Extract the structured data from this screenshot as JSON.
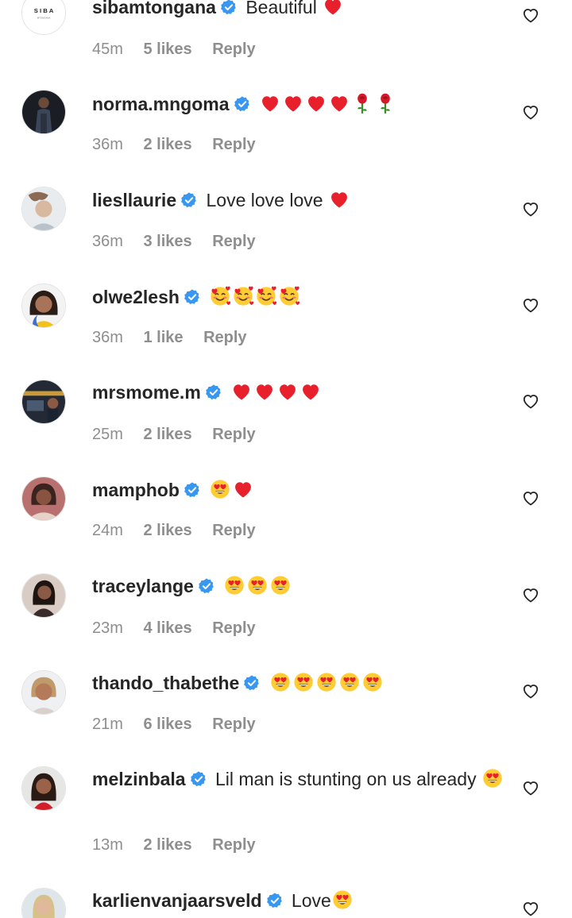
{
  "colors": {
    "text": "#262626",
    "meta": "#8e8e8e",
    "verified": "#3897f0",
    "heart": "#e8202c"
  },
  "comments": [
    {
      "username": "sibamtongana",
      "text": "Beautiful",
      "emoji": [
        "red-heart"
      ],
      "time": "45m",
      "likes": "5 likes",
      "reply": "Reply",
      "avatar_text": "S I B A",
      "avatar_subtext": "MTONGANA"
    },
    {
      "username": "norma.mngoma",
      "text": "",
      "emoji": [
        "red-heart",
        "red-heart",
        "red-heart",
        "red-heart",
        "rose",
        "rose"
      ],
      "time": "36m",
      "likes": "2 likes",
      "reply": "Reply"
    },
    {
      "username": "liesllaurie",
      "text": "Love love love",
      "emoji": [
        "red-heart"
      ],
      "time": "36m",
      "likes": "3 likes",
      "reply": "Reply"
    },
    {
      "username": "olwe2lesh",
      "text": "",
      "emoji": [
        "smiling-face-with-hearts",
        "smiling-face-with-hearts",
        "smiling-face-with-hearts",
        "smiling-face-with-hearts"
      ],
      "time": "36m",
      "likes": "1 like",
      "reply": "Reply"
    },
    {
      "username": "mrsmome.m",
      "text": "",
      "emoji": [
        "red-heart",
        "red-heart",
        "red-heart",
        "red-heart"
      ],
      "time": "25m",
      "likes": "2 likes",
      "reply": "Reply"
    },
    {
      "username": "mamphob",
      "text": "",
      "emoji": [
        "heart-eyes",
        "red-heart"
      ],
      "time": "24m",
      "likes": "2 likes",
      "reply": "Reply"
    },
    {
      "username": "traceylange",
      "text": "",
      "emoji": [
        "heart-eyes",
        "heart-eyes",
        "heart-eyes"
      ],
      "time": "23m",
      "likes": "4 likes",
      "reply": "Reply"
    },
    {
      "username": "thando_thabethe",
      "text": "",
      "emoji": [
        "heart-eyes",
        "heart-eyes",
        "heart-eyes",
        "heart-eyes",
        "heart-eyes"
      ],
      "time": "21m",
      "likes": "6 likes",
      "reply": "Reply"
    },
    {
      "username": "melzinbala",
      "text": "Lil man is stunting on us already",
      "emoji": [
        "heart-eyes"
      ],
      "time": "13m",
      "likes": "2 likes",
      "reply": "Reply"
    },
    {
      "username": "karlienvanjaarsveld",
      "text": "Love",
      "emoji": [
        "heart-eyes"
      ],
      "time": "",
      "likes": "",
      "reply": ""
    }
  ]
}
